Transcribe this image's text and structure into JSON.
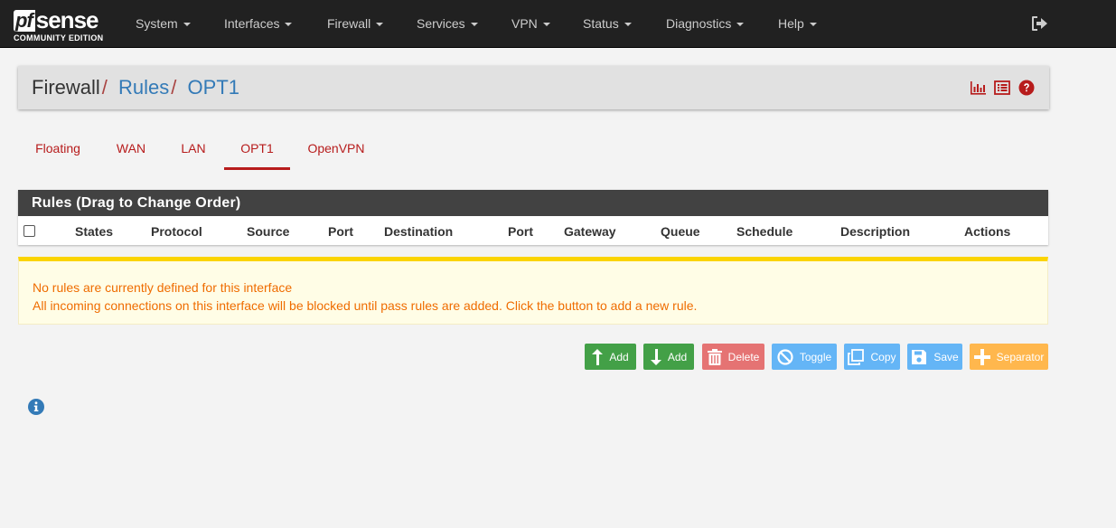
{
  "brand": {
    "name_pf": "pf",
    "name_sense": "sense",
    "edition": "COMMUNITY EDITION"
  },
  "nav": {
    "items": [
      {
        "label": "System"
      },
      {
        "label": "Interfaces"
      },
      {
        "label": "Firewall"
      },
      {
        "label": "Services"
      },
      {
        "label": "VPN"
      },
      {
        "label": "Status"
      },
      {
        "label": "Diagnostics"
      },
      {
        "label": "Help"
      }
    ],
    "logout_icon": "sign-out-icon"
  },
  "breadcrumb": {
    "items": [
      "Firewall",
      "Rules",
      "OPT1"
    ],
    "separator": "/",
    "icons": [
      "bar-chart-icon",
      "list-icon",
      "question-circle-icon"
    ]
  },
  "tabs": [
    {
      "label": "Floating"
    },
    {
      "label": "WAN"
    },
    {
      "label": "LAN"
    },
    {
      "label": "OPT1",
      "active": true
    },
    {
      "label": "OpenVPN"
    }
  ],
  "rules_panel": {
    "title": "Rules (Drag to Change Order)",
    "columns": [
      "States",
      "Protocol",
      "Source",
      "Port",
      "Destination",
      "Port",
      "Gateway",
      "Queue",
      "Schedule",
      "Description",
      "Actions"
    ]
  },
  "alert": {
    "line1": "No rules are currently defined for this interface",
    "line2": "All incoming connections on this interface will be blocked until pass rules are added. Click the button to add a new rule."
  },
  "buttons": {
    "add_top": "Add",
    "add_bottom": "Add",
    "delete": "Delete",
    "toggle": "Toggle",
    "copy": "Copy",
    "save": "Save",
    "separator": "Separator"
  },
  "colors": {
    "navbar": "#212121",
    "accent_red": "#b71c1c",
    "link_blue": "#337ab7",
    "success": "#43a047",
    "danger": "#e57373",
    "info": "#64b5f6",
    "warning": "#ffb74d",
    "alert_text": "#ef6c00",
    "alert_border": "#fbd400"
  }
}
